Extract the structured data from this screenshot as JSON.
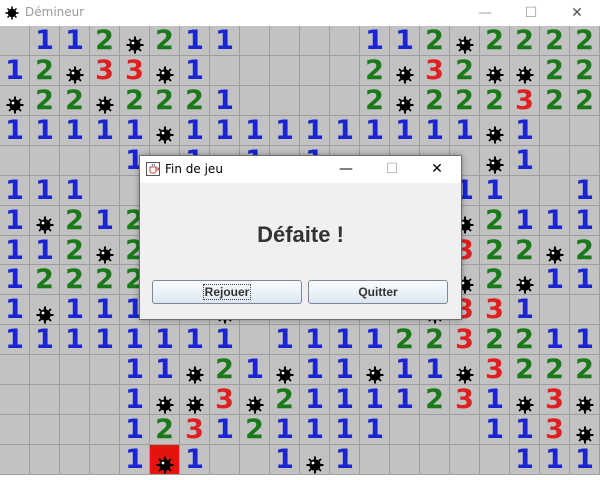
{
  "window": {
    "title": "Démineur",
    "minimize": "—",
    "maximize": "☐",
    "close": "✕"
  },
  "dialog": {
    "title": "Fin de jeu",
    "message": "Défaite !",
    "minimize": "—",
    "maximize": "☐",
    "close": "✕",
    "replay_label": "Rejouer",
    "quit_label": "Quitter"
  },
  "colors": {
    "one": "#1a25d1",
    "two": "#1a7a1a",
    "three": "#e02020",
    "cell": "#c2c2c2",
    "grid": "#9e9e9e",
    "exploded": "#e3140c"
  },
  "board": {
    "legend": "0 = empty, 1-8 = count, * = mine, X = exploded mine",
    "rows": [
      "0112*2110000112*22221",
      "12*33*1000002*32**221",
      "*22*222100002*22232210",
      "11111*1111111111*1000",
      "00001*101*100000*1000",
      "1110011011100111100110",
      "1*212*111111112*21112*",
      "112*2*1112*1112322*2*",
      "12222113*1112*3*2*1111",
      "1*11112*101133*331000",
      "11111111011112232211000",
      "000011*21*11*11*3222*1",
      "00001**3*21111231*3*1",
      "0000123121111000113*1",
      "00001X1001*1000001111"
    ]
  }
}
